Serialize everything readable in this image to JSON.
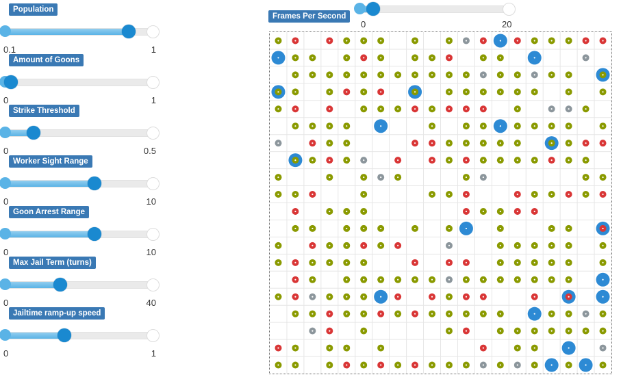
{
  "sliders": [
    {
      "label": "Population",
      "min_label": "0.1",
      "max_label": "1",
      "min": 0.1,
      "max": 1,
      "value": 0.84
    },
    {
      "label": "Amount of Goons",
      "min_label": "0",
      "max_label": "1",
      "min": 0,
      "max": 1,
      "value": 0.05
    },
    {
      "label": "Strike Threshold",
      "min_label": "0",
      "max_label": "0.5",
      "min": 0,
      "max": 0.5,
      "value": 0.1
    },
    {
      "label": "Worker Sight Range",
      "min_label": "0",
      "max_label": "10",
      "min": 0,
      "max": 10,
      "value": 6
    },
    {
      "label": "Goon Arrest Range",
      "min_label": "0",
      "max_label": "10",
      "min": 0,
      "max": 10,
      "value": 6
    },
    {
      "label": "Max Jail Term (turns)",
      "min_label": "0",
      "max_label": "40",
      "min": 0,
      "max": 40,
      "value": 15
    },
    {
      "label": "Jailtime ramp-up speed",
      "min_label": "0",
      "max_label": "1",
      "min": 0,
      "max": 1,
      "value": 0.4
    }
  ],
  "fps": {
    "label": "Frames Per Second",
    "min_label": "0",
    "max_label": "20",
    "min": 0,
    "max": 20,
    "value": 2
  },
  "colors": {
    "worker": "#8a9a00",
    "striker": "#d93636",
    "jailed": "#8c969c",
    "goon": "#2d8ad4",
    "label_bg": "#3a79b4",
    "thumb": "#1a89d0"
  },
  "grid": {
    "cols": 20,
    "rows": 20,
    "legend_codes": {
      "W": "worker-agent",
      "S": "striking-agent",
      "J": "jailed-agent",
      "B": "goon-agent",
      "B_on_W": "goon-on-worker",
      "B_on_S": "goon-on-striker"
    },
    "cells": [
      "W S . S W W W . W . W J S B S W W W S S",
      "B W W . W S W . W W S . W W . B . . J .",
      ". W W W W W W W W W W W J W W J W W . BW",
      "BW W . W S W S . BW . W W W W W W . W . W",
      "W S . S . W W W S W S S S . W . J J W .",
      ". W W W W . B . . W . W W B W W W W . W",
      "J . S W W . . . S S W W W W W . BW W S S",
      ". BW W S W J . S . S W S W W W W S W W .",
      "W . . W . W J W . . . W J . . . . . W W",
      "W W S . . W . . . W W S . . S W W S W S",
      ". S . W W W . . . . . S W W S S . . . .",
      ". W W . W W W . W . W B . W . . W W . BS",
      "W . S W W S W S . . J . . W W W W W . W",
      "W S W W W W . . S . S S . W W W W W . W",
      ". S W . W W W W W W J W W W W W W W . B",
      "W S J W W W B S . S W S S . . S . BS . B",
      ". W W S W W S W S W W W W W . B W W J W",
      ". . J S . W . . . . W S . W W W W W W W",
      "S W . W W . W . . . . . S . W W . B . J",
      "W W . W S W S W S W W W J W J W B W B W"
    ]
  }
}
